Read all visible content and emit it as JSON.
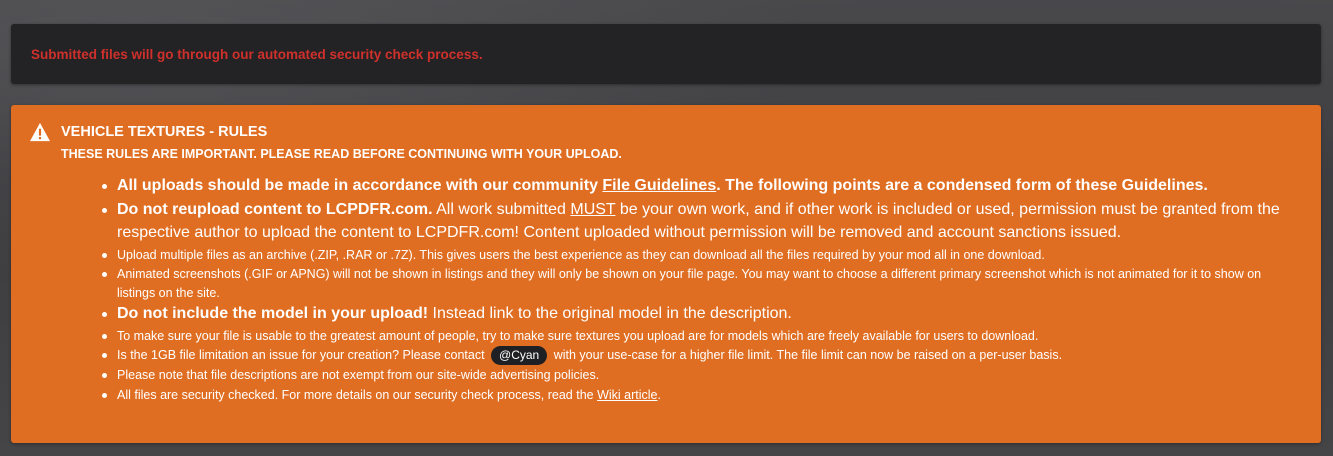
{
  "notice": {
    "text": "Submitted files will go through our automated security check process."
  },
  "rules": {
    "title": "VEHICLE TEXTURES - RULES",
    "subtitle": "THESE RULES ARE IMPORTANT. PLEASE READ BEFORE CONTINUING WITH YOUR UPLOAD.",
    "items": [
      {
        "size": "big",
        "a": "All uploads should be made in accordance with our community ",
        "link": "File Guidelines",
        "b": ". The following points are a condensed form of these Guidelines."
      },
      {
        "size": "big",
        "bold": "Do not reupload content to LCPDFR.com.",
        "a": " All work submitted ",
        "must": "MUST",
        "b": " be your own work, and if other work is included or used, permission must be granted from the respective author to upload the content to LCPDFR.com! Content uploaded without permission will be removed and account sanctions issued."
      },
      {
        "size": "small",
        "text": "Upload multiple files as an archive (.ZIP, .RAR or .7Z). This gives users the best experience as they can download all the files required by your mod all in one download."
      },
      {
        "size": "small",
        "text": "Animated screenshots (.GIF or APNG) will not be shown in listings and they will only be shown on your file page. You may want to choose a different primary screenshot which is not animated for it to show on listings on the site."
      },
      {
        "size": "big",
        "bold": "Do not include the model in your upload!",
        "a": " Instead link to the original model in the description."
      },
      {
        "size": "small",
        "text": "To make sure your file is usable to the greatest amount of people, try to make sure textures you upload are for models which are freely available for users to download."
      },
      {
        "size": "small",
        "a": "Is the 1GB file limitation an issue for your creation? Please contact ",
        "mention": "@Cyan",
        "b": " with your use-case for a higher file limit. The file limit can now be raised on a per-user basis."
      },
      {
        "size": "small",
        "text": "Please note that file descriptions are not exempt from our site-wide advertising policies."
      },
      {
        "size": "small",
        "a": "All files are security checked. For more details on our security check process, read the ",
        "link": "Wiki article",
        "b": "."
      }
    ]
  },
  "colors": {
    "page_bg": "#404043",
    "notice_bg": "#232325",
    "notice_text": "#d0302b",
    "rules_bg": "#e06e22",
    "mention_bg": "#1f2024"
  },
  "icons": {
    "rules_header": "warning-triangle-icon"
  }
}
